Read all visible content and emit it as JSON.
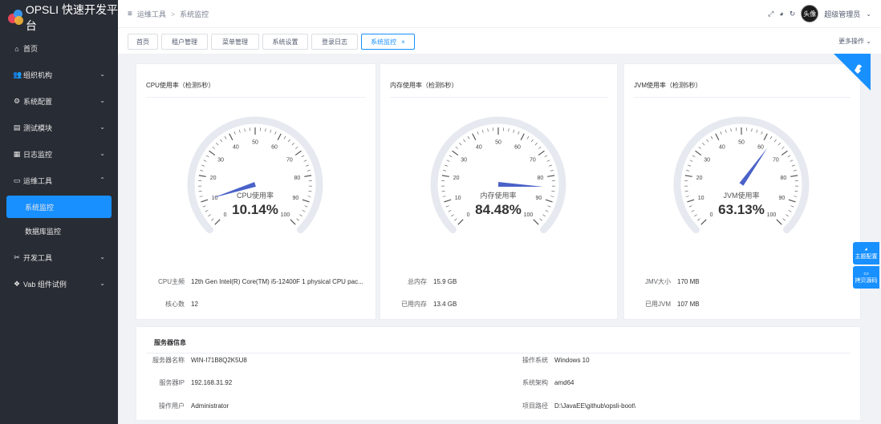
{
  "app": {
    "title": "OPSLI 快速开发平台"
  },
  "sidebar": {
    "items": [
      {
        "label": "首页",
        "icon": "home-icon",
        "glyph": "⌂",
        "arrow": false
      },
      {
        "label": "组织机构",
        "icon": "users-icon",
        "glyph": "👥",
        "arrow": true
      },
      {
        "label": "系统配置",
        "icon": "gear-icon",
        "glyph": "⚙",
        "arrow": true
      },
      {
        "label": "测试模块",
        "icon": "box-icon",
        "glyph": "▤",
        "arrow": true
      },
      {
        "label": "日志监控",
        "icon": "log-icon",
        "glyph": "▦",
        "arrow": true
      },
      {
        "label": "运维工具",
        "icon": "monitor-icon",
        "glyph": "▭",
        "arrow": true,
        "expanded": true
      },
      {
        "label": "系统监控",
        "sub": true,
        "active": true
      },
      {
        "label": "数据库监控",
        "sub": true
      },
      {
        "label": "开发工具",
        "icon": "tools-icon",
        "glyph": "✂",
        "arrow": true
      },
      {
        "label": "Vab 组件试例",
        "icon": "puzzle-icon",
        "glyph": "❖",
        "arrow": true
      }
    ]
  },
  "header": {
    "breadcrumb": [
      "运维工具",
      "系统监控"
    ],
    "user": "超级管理员",
    "avatar_text": "头像"
  },
  "tabs": [
    {
      "label": "首页"
    },
    {
      "label": "租户管理"
    },
    {
      "label": "菜单管理"
    },
    {
      "label": "系统设置"
    },
    {
      "label": "登录日志"
    },
    {
      "label": "系统监控",
      "active": true,
      "close": "×"
    }
  ],
  "more_ops": "更多操作",
  "gauges": [
    {
      "title": "CPU使用率（检测5秒）",
      "name": "CPU使用率",
      "value": 10.14,
      "value_text": "10.14%"
    },
    {
      "title": "内存使用率（检测5秒）",
      "name": "内存使用率",
      "value": 84.48,
      "value_text": "84.48%"
    },
    {
      "title": "JVM使用率（检测5秒）",
      "name": "JVM使用率",
      "value": 63.13,
      "value_text": "63.13%"
    }
  ],
  "gauge_ticks": [
    "0",
    "10",
    "20",
    "30",
    "40",
    "50",
    "60",
    "70",
    "80",
    "90",
    "100"
  ],
  "gauge_color": "#4a62c8",
  "cpu_info": {
    "model_label": "CPU主频",
    "model": "12th Gen Intel(R) Core(TM) i5-12400F 1 physical CPU pac...",
    "cores_label": "核心数",
    "cores": "12"
  },
  "mem_info": {
    "total_label": "总内存",
    "total": "15.9 GB",
    "used_label": "已用内存",
    "used": "13.4 GB"
  },
  "jvm_info": {
    "size_label": "JMV大小",
    "size": "170 MB",
    "used_label": "已用JVM",
    "used": "107 MB"
  },
  "server": {
    "title": "服务器信息",
    "name_label": "服务器名称",
    "name": "WIN-I71B8Q2K5U8",
    "ip_label": "服务器IP",
    "ip": "192.168.31.92",
    "user_label": "操作用户",
    "user": "Administrator",
    "os_label": "操作系统",
    "os": "Windows 10",
    "arch_label": "系统架构",
    "arch": "amd64",
    "path_label": "项目路径",
    "path": "D:\\JavaEE\\github\\opsli-boot\\"
  },
  "side_buttons": {
    "theme": "主题配置",
    "source": "拷贝源码"
  },
  "accent": "#1890ff"
}
